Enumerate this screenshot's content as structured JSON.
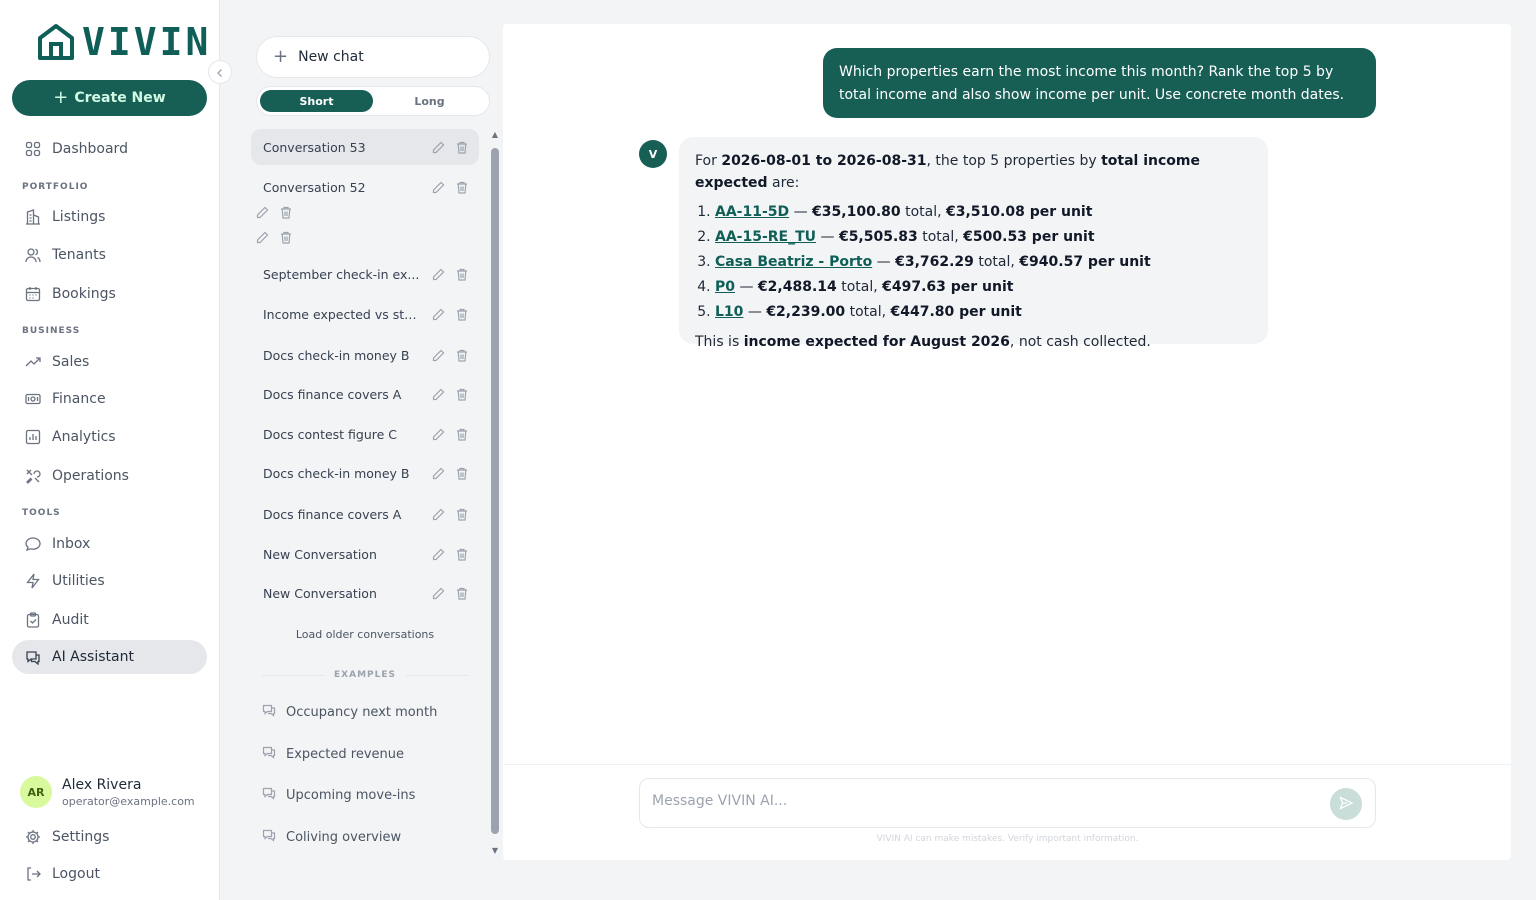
{
  "app": {
    "logo_text": "VIVIN",
    "create_label": "Create New"
  },
  "colors": {
    "brand": "#175e55",
    "brand_dark": "#0f5e57",
    "avatar_bg": "#d9f99d"
  },
  "nav": {
    "dashboard": "Dashboard",
    "portfolio_section": "PORTFOLIO",
    "listings": "Listings",
    "tenants": "Tenants",
    "bookings": "Bookings",
    "business_section": "BUSINESS",
    "sales": "Sales",
    "finance": "Finance",
    "analytics": "Analytics",
    "operations": "Operations",
    "tools_section": "TOOLS",
    "inbox": "Inbox",
    "utilities": "Utilities",
    "audit": "Audit",
    "ai_assistant": "AI Assistant"
  },
  "user": {
    "initials": "AR",
    "name": "Alex Rivera",
    "email": "operator@example.com"
  },
  "footer_nav": {
    "settings": "Settings",
    "logout": "Logout"
  },
  "conversations": {
    "new_chat": "New chat",
    "mode_short": "Short",
    "mode_long": "Long",
    "items": [
      "Conversation 53",
      "Conversation 52",
      "",
      "",
      "September check-in ex...",
      "Income expected vs sta...",
      "Docs check-in money B",
      "Docs finance covers A",
      "Docs contest figure C",
      "Docs check-in money B",
      "Docs finance covers A",
      "New Conversation",
      "New Conversation"
    ],
    "load_older": "Load older conversations",
    "examples_heading": "EXAMPLES",
    "examples": [
      "Occupancy next month",
      "Expected revenue",
      "Upcoming move-ins",
      "Coliving overview"
    ]
  },
  "chat": {
    "user_message": "Which properties earn the most income this month? Rank the top 5 by total income and also show income per unit. Use concrete month dates.",
    "bot_initial": "V",
    "intro_prefix": "For ",
    "intro_range": "2026-08-01 to 2026-08-31",
    "intro_mid": ", the top 5 properties by ",
    "intro_metric": "total income expected",
    "intro_suffix": " are:",
    "rankings": [
      {
        "name": "AA-11-5D",
        "total": "€35,100.80",
        "per_unit": "€3,510.08 per unit"
      },
      {
        "name": "AA-15-RE_TU",
        "total": "€5,505.83",
        "per_unit": "€500.53 per unit"
      },
      {
        "name": "Casa Beatriz - Porto",
        "total": "€3,762.29",
        "per_unit": "€940.57 per unit"
      },
      {
        "name": "P0",
        "total": "€2,488.14",
        "per_unit": "€497.63 per unit"
      },
      {
        "name": "L10",
        "total": "€2,239.00",
        "per_unit": "€447.80 per unit"
      }
    ],
    "dash": " — ",
    "total_word": " total, ",
    "note_prefix": "This is ",
    "note_bold": "income expected for August 2026",
    "note_suffix": ", not cash collected.",
    "input_placeholder": "Message VIVIN AI...",
    "disclaimer": "VIVIN AI can make mistakes. Verify important information."
  }
}
